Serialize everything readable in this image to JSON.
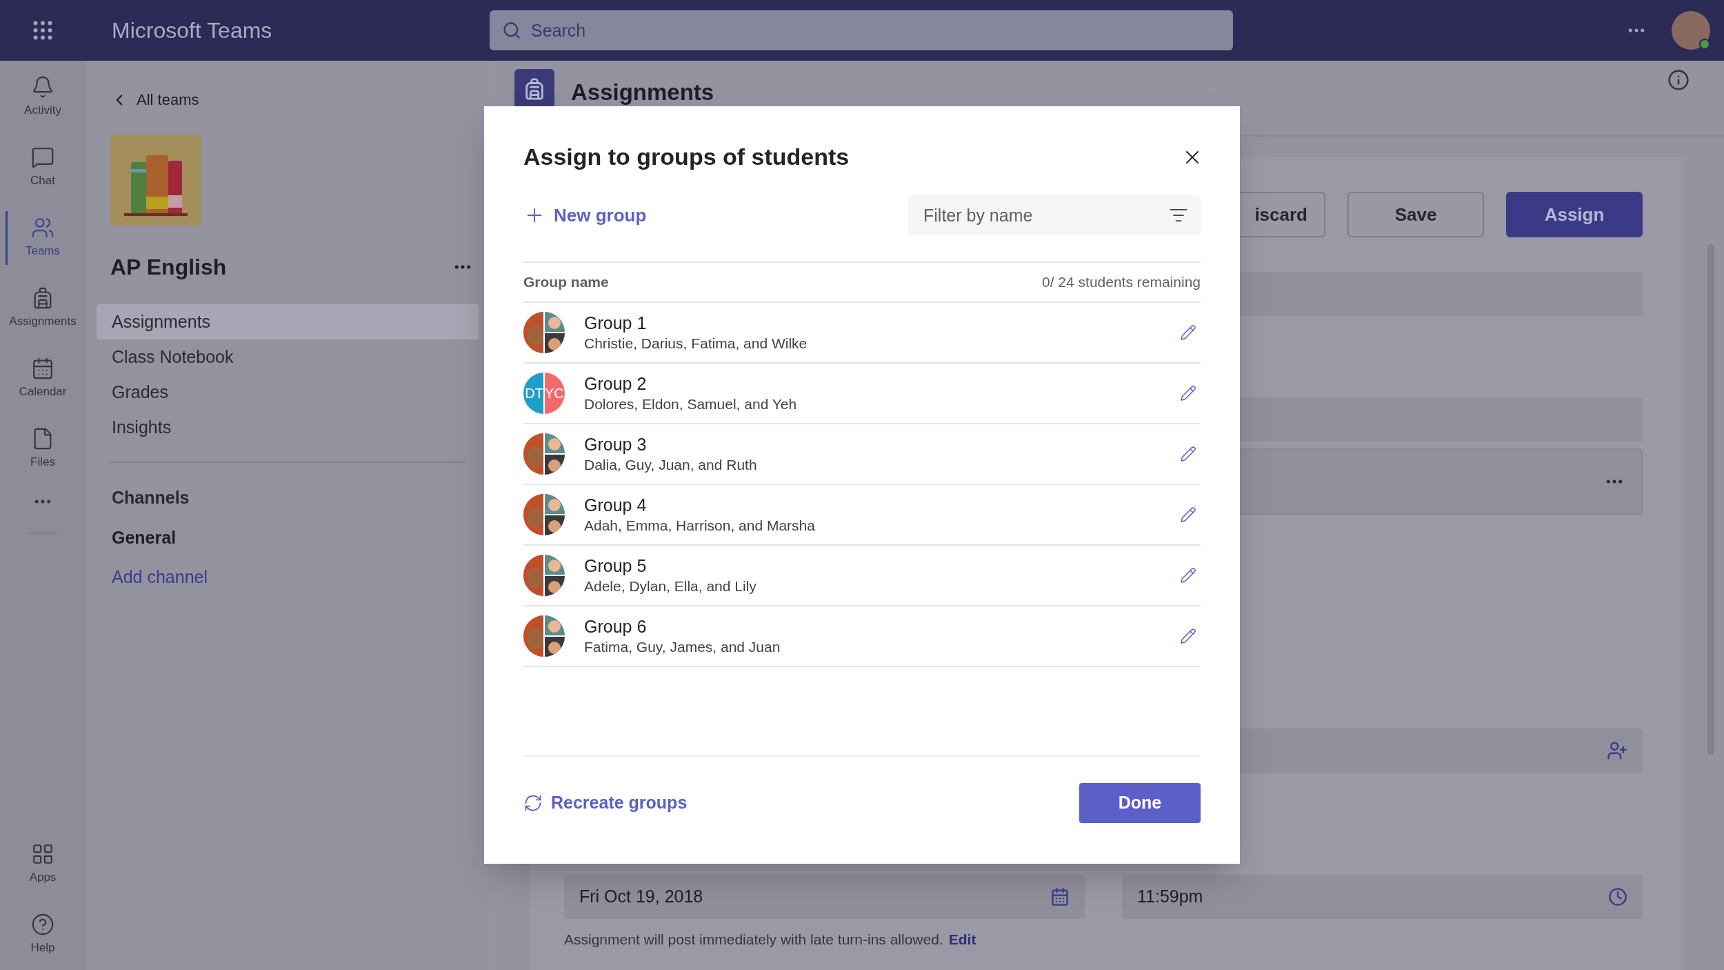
{
  "app_bar": {
    "title": "Microsoft Teams",
    "search": {
      "placeholder": "Search"
    }
  },
  "rail": [
    {
      "kind": "bell",
      "label": "Activity",
      "selected": false
    },
    {
      "kind": "chat",
      "label": "Chat",
      "selected": false
    },
    {
      "kind": "teams",
      "label": "Teams",
      "selected": true
    },
    {
      "kind": "backpack",
      "label": "Assignments",
      "selected": false
    },
    {
      "kind": "calendar",
      "label": "Calendar",
      "selected": false
    },
    {
      "kind": "file",
      "label": "Files",
      "selected": false
    }
  ],
  "rail_bottom": [
    {
      "kind": "apps",
      "label": "Apps",
      "selected": false
    },
    {
      "kind": "help",
      "label": "Help",
      "selected": false
    }
  ],
  "sidebar": {
    "back": "All teams",
    "team_name": "AP English",
    "items": [
      {
        "label": "Assignments",
        "selected": true
      },
      {
        "label": "Class Notebook",
        "selected": false
      },
      {
        "label": "Grades",
        "selected": false
      },
      {
        "label": "Insights",
        "selected": false
      }
    ],
    "channels_heading": "Channels",
    "channels": [
      "General"
    ],
    "add_channel": "Add channel"
  },
  "main": {
    "title": "Assignments",
    "buttons": [
      {
        "label": "iscard",
        "primary": false
      },
      {
        "label": "Save",
        "primary": false
      },
      {
        "label": "Assign",
        "primary": true
      }
    ],
    "due_date": "Fri Oct 19, 2018",
    "due_time": "11:59pm",
    "note": "Assignment will post immediately with late turn-ins allowed.",
    "note_link": "Edit"
  },
  "dialog": {
    "title": "Assign to groups of students",
    "new_group": "New group",
    "filter": {
      "placeholder": "Filter by name"
    },
    "columns": [
      "Group name",
      "0/ 24 students remaining"
    ],
    "groups": [
      {
        "name": "Group 1",
        "members": "Christie, Darius, Fatima, and Wilke"
      },
      {
        "name": "Group 2",
        "members": "Dolores, Eldon, Samuel, and Yeh",
        "avatar": {
          "kind": "initials",
          "initials": [
            "DT",
            "YC"
          ]
        }
      },
      {
        "name": "Group 3",
        "members": "Dalia, Guy, Juan, and Ruth"
      },
      {
        "name": "Group 4",
        "members": "Adah, Emma, Harrison, and Marsha"
      },
      {
        "name": "Group 5",
        "members": "Adele, Dylan, Ella, and Lily"
      },
      {
        "name": "Group 6",
        "members": "Fatima, Guy, James, and Juan"
      }
    ],
    "recreate": "Recreate groups",
    "done": "Done"
  }
}
